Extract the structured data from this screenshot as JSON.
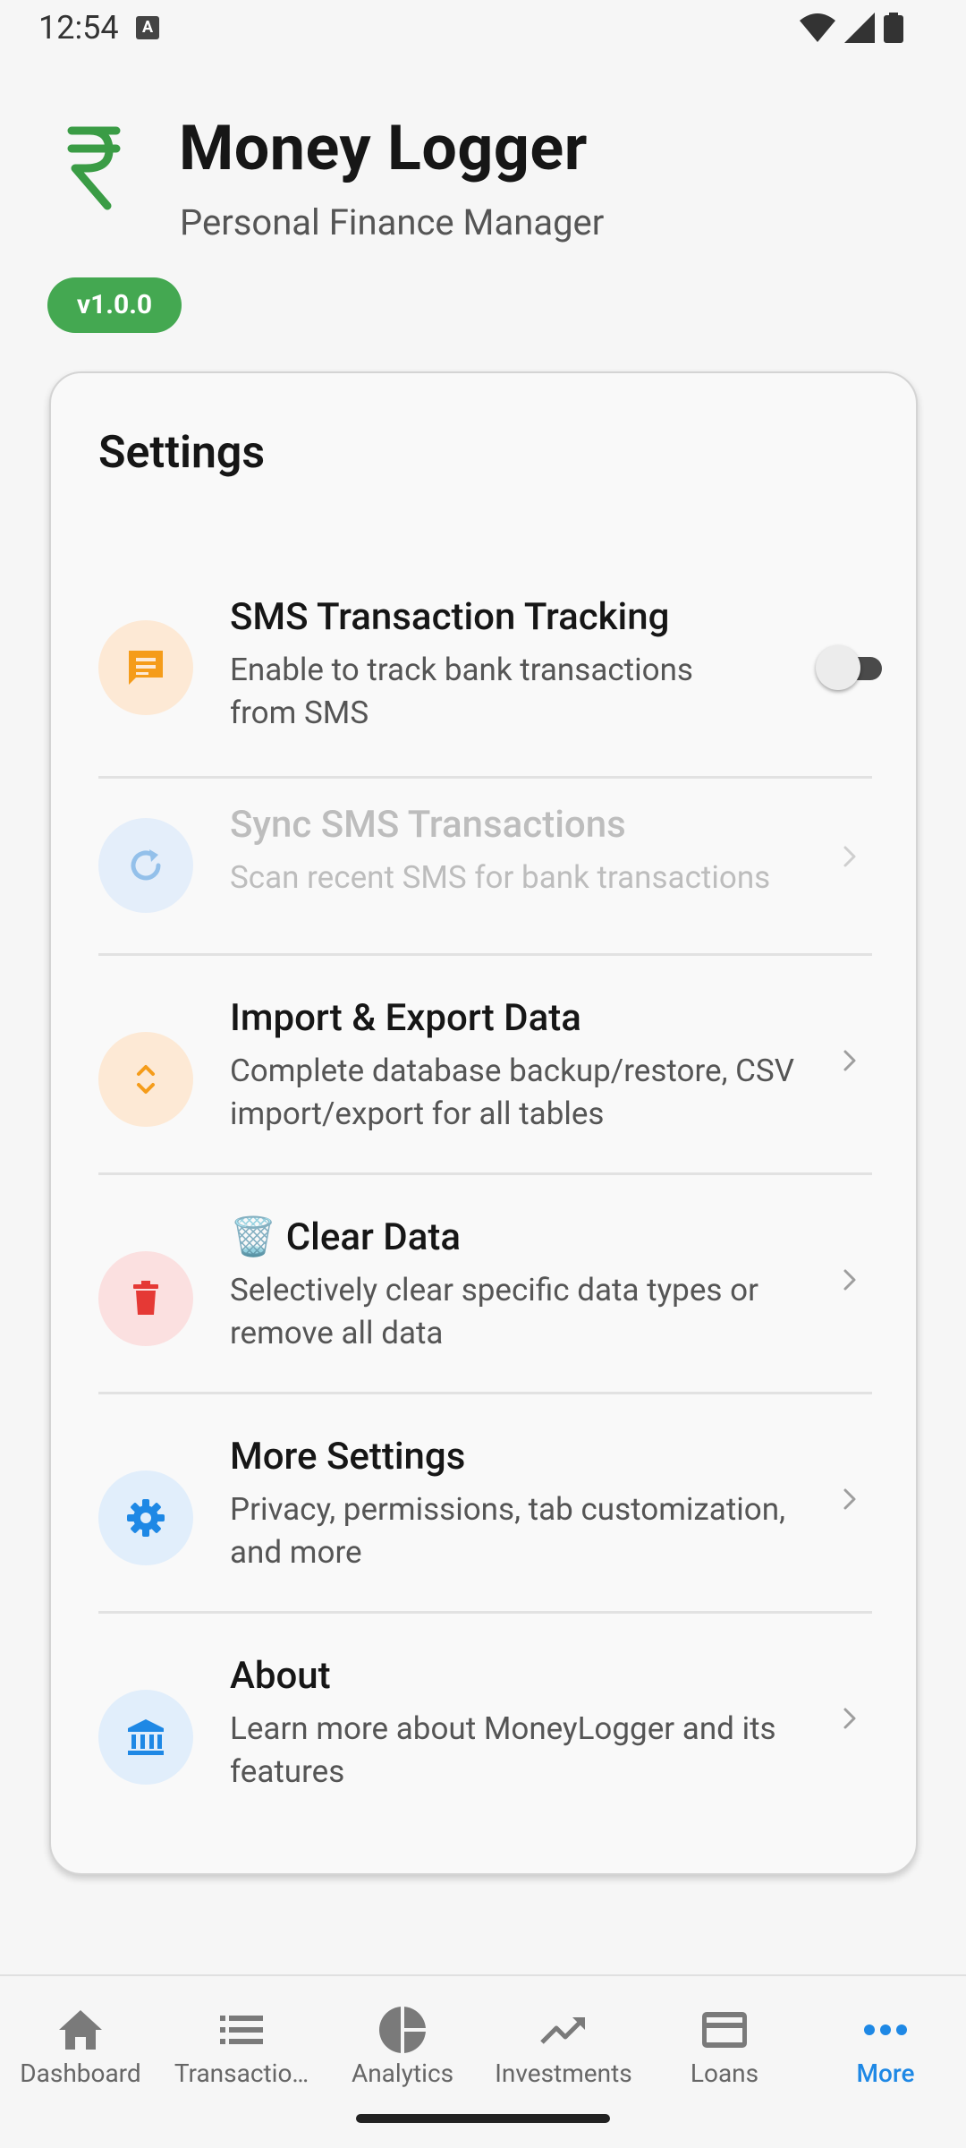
{
  "status_bar": {
    "time": "12:54",
    "a_icon": "A"
  },
  "header": {
    "icon": "rupee-icon",
    "title": "Money Logger",
    "subtitle": "Personal Finance Manager",
    "version": "v1.0.0"
  },
  "settings": {
    "title": "Settings",
    "items": [
      {
        "title": "SMS Transaction Tracking",
        "desc": "Enable to track bank transactions from SMS",
        "icon": "message-icon",
        "toggle_on": false
      },
      {
        "title": "Sync SMS Transactions",
        "desc": "Scan recent SMS for bank transactions",
        "icon": "refresh-icon",
        "disabled": true
      },
      {
        "title": "Import & Export Data",
        "desc": "Complete database backup/restore, CSV import/export for all tables",
        "icon": "import-export-icon"
      },
      {
        "title": "🗑️ Clear Data",
        "desc": "Selectively clear specific data types or remove all data",
        "icon": "trash-icon"
      },
      {
        "title": "More Settings",
        "desc": "Privacy, permissions, tab customization, and more",
        "icon": "gear-icon"
      },
      {
        "title": "About",
        "desc": "Learn more about MoneyLogger and its features",
        "icon": "bank-icon"
      }
    ]
  },
  "nav": {
    "items": [
      {
        "label": "Dashboard",
        "icon": "home-icon"
      },
      {
        "label": "Transactio…",
        "icon": "list-icon"
      },
      {
        "label": "Analytics",
        "icon": "pie-chart-icon"
      },
      {
        "label": "Investments",
        "icon": "trending-up-icon"
      },
      {
        "label": "Loans",
        "icon": "credit-card-icon"
      },
      {
        "label": "More",
        "icon": "more-icon",
        "active": true
      }
    ]
  },
  "colors": {
    "accent": "#1e88e5",
    "brand_green": "#44a851",
    "orange": "#f59c1a",
    "red": "#e53935"
  }
}
